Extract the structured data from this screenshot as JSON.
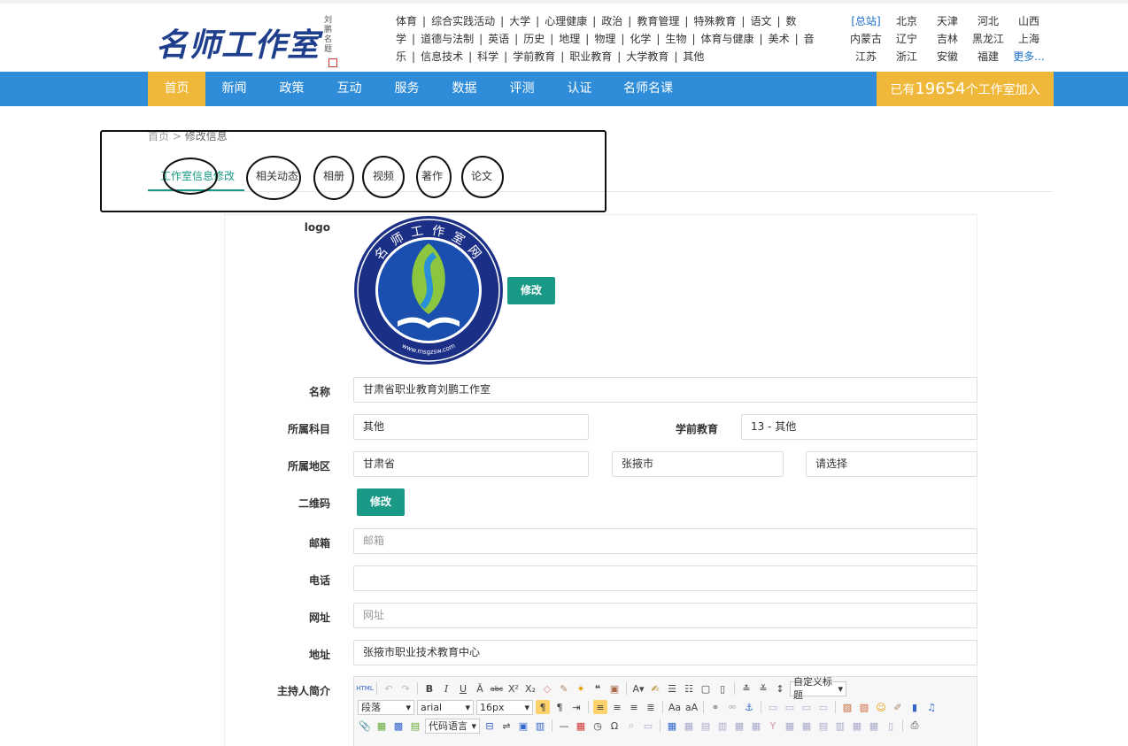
{
  "header": {
    "logo_text": "名师工作室网",
    "logo_side_text": "刘鹏名题",
    "subjects": [
      "体育",
      "综合实践活动",
      "大学",
      "心理健康",
      "政治",
      "教育管理",
      "特殊教育",
      "语文",
      "数学",
      "道德与法制",
      "英语",
      "历史",
      "地理",
      "物理",
      "化学",
      "生物",
      "体育与健康",
      "美术",
      "音乐",
      "信息技术",
      "科学",
      "学前教育",
      "职业教育",
      "大学教育",
      "其他"
    ],
    "regions": [
      [
        "[总站]",
        "北京",
        "天津",
        "河北",
        "山西"
      ],
      [
        "内蒙古",
        "辽宁",
        "吉林",
        "黑龙江",
        "上海"
      ],
      [
        "江苏",
        "浙江",
        "安徽",
        "福建",
        "更多..."
      ]
    ]
  },
  "nav": {
    "items": [
      "首页",
      "新闻",
      "政策",
      "互动",
      "服务",
      "数据",
      "评测",
      "认证",
      "名师名课"
    ],
    "join_prefix": "已有",
    "join_count": "19654",
    "join_suffix": "个工作室加入"
  },
  "breadcrumb": {
    "home": "首页",
    "sep": ">",
    "current": "修改信息"
  },
  "tabs": [
    "工作室信息修改",
    "相关动态",
    "相册",
    "视频",
    "著作",
    "论文"
  ],
  "emblem": {
    "top_text": "名 师 工 作 室 网",
    "left_url": "www.msgzsw.com",
    "right_url": "moc.wszgsm.www"
  },
  "form": {
    "logo_label": "logo",
    "logo_button": "修改",
    "name_label": "名称",
    "name_value": "甘肃省职业教育刘鹏工作室",
    "subject_label": "所属科目",
    "subject_value": "其他",
    "stage_label": "学前教育",
    "stage_value": "13 - 其他",
    "area_label": "所属地区",
    "province": "甘肃省",
    "city": "张掖市",
    "district": "请选择",
    "qr_label": "二维码",
    "qr_button": "修改",
    "email_label": "邮箱",
    "email_placeholder": "邮箱",
    "phone_label": "电话",
    "phone_value": "",
    "site_label": "网址",
    "site_placeholder": "网址",
    "addr_label": "地址",
    "addr_value": "张掖市职业技术教育中心",
    "intro_label": "主持人简介"
  },
  "editor": {
    "format_select": "段落",
    "font_select": "arial",
    "size_select": "16px",
    "heading_select": "自定义标题",
    "code_select": "代码语言",
    "html_label": "HTML"
  }
}
